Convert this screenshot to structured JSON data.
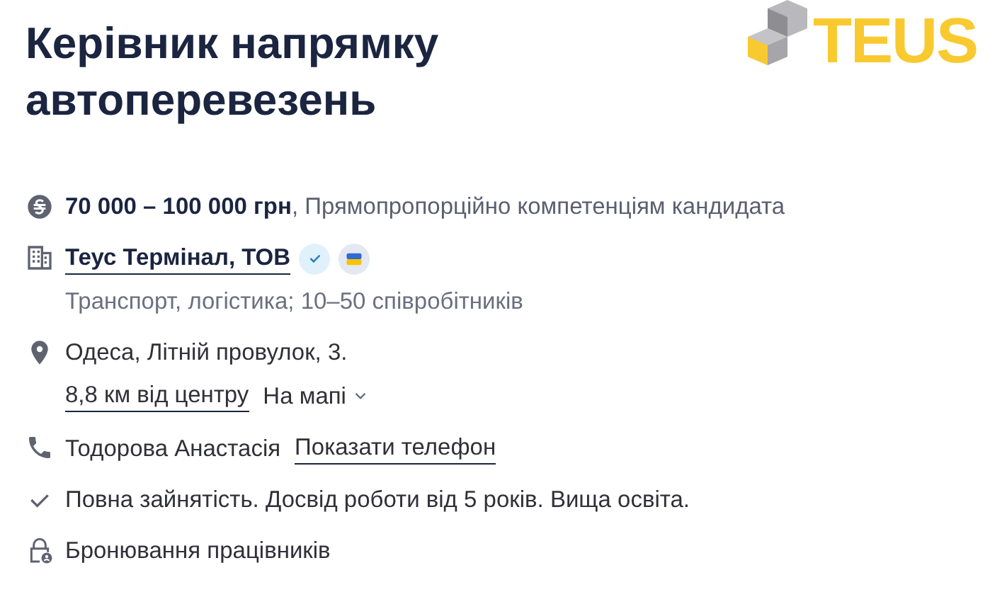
{
  "title": "Керівник напрямку автоперевезень",
  "logo": {
    "text": "TEUS"
  },
  "salary": {
    "amount": "70 000 – 100 000 грн",
    "note": ", Прямопропорційно компетенціям кандидата"
  },
  "company": {
    "name": "Теус Термінал, ТОВ",
    "badges": [
      {
        "kind": "verified"
      },
      {
        "kind": "flag"
      }
    ],
    "industry": "Транспорт, логістика; 10–50 співробітників"
  },
  "address": {
    "text": "Одеса, Літній провулок, 3.",
    "distance": "8,8 км від центру",
    "map_toggle": "На мапі",
    "expanded": false
  },
  "contact": {
    "name": "Тодорова Анастасія",
    "phone_link": "Показати телефон"
  },
  "requirements": "Повна зайнятість. Досвід роботи від 5 років. Вища освіта.",
  "reservation": "Бронювання працівників"
}
